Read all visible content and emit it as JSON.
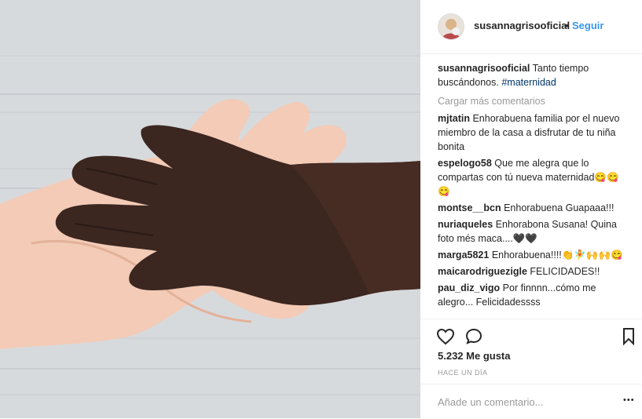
{
  "post": {
    "username": "susannagrisooficial",
    "dot": "•",
    "follow_label": "Seguir",
    "caption_text": "Tanto tiempo buscándonos.",
    "caption_tag": "#maternidad",
    "load_more": "Cargar más comentarios",
    "comments": [
      {
        "user": "mjtatin",
        "text": "Enhorabuena familia por el nuevo miembro de la casa a disfrutar de tu niña bonita"
      },
      {
        "user": "espelogo58",
        "text": "Que me alegra que lo compartas con tú nueva maternidad😋😋😋"
      },
      {
        "user": "montse__bcn",
        "text": "Enhorabuena Guapaaa!!!"
      },
      {
        "user": "nuriaqueles",
        "text": "Enhorabona Susana! Quina foto més maca....🖤🖤"
      },
      {
        "user": "marga5821",
        "text": "Enhorabuena!!!!👏🧚🙌🙌😋"
      },
      {
        "user": "maicarodriguezigle",
        "text": "FELICIDADES!!"
      },
      {
        "user": "pau_diz_vigo",
        "text": "Por finnnn...cómo me alegro... Felicidadessss"
      }
    ],
    "likes": "5.232 Me gusta",
    "time": "HACE UN DÍA",
    "add_comment_placeholder": "Añade un comentario...",
    "more_dots": "•••"
  },
  "icons": [
    "heart-icon",
    "comment-icon",
    "bookmark-icon",
    "more-options-icon"
  ]
}
